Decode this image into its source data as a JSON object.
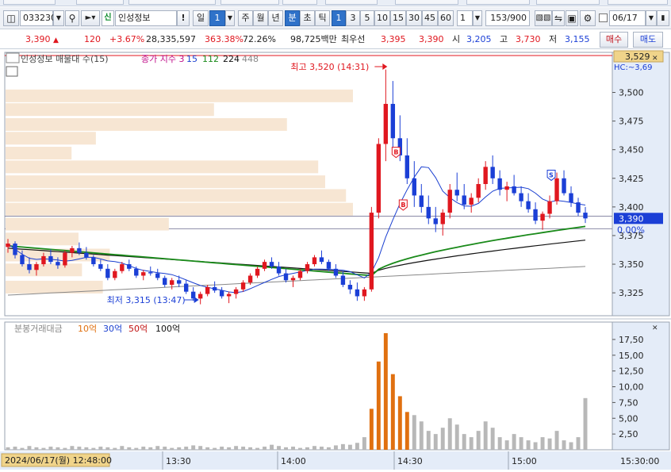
{
  "toolbar": {
    "layout_icon": "layout-icon",
    "stock_code": "033230",
    "dropdown_icon": "chevron-down-icon",
    "search_icon": "search-icon",
    "speaker_icon": "speaker-icon",
    "credit_badge": "신",
    "stock_name": "인성정보",
    "alert_label": "!",
    "period_buttons": [
      "일",
      "1",
      "주",
      "월",
      "년",
      "분",
      "초",
      "틱"
    ],
    "interval_buttons": [
      "1",
      "3",
      "5",
      "10",
      "15",
      "30",
      "45",
      "60"
    ],
    "interval_value": "1",
    "count_display": "153/900",
    "date_value": "06/17"
  },
  "quote": {
    "price": "3,390",
    "change": "120",
    "change_rate": "+3.67%",
    "volume": "28,335,597",
    "volume_ratio": "363.38%",
    "turnover_rate": "72.26%",
    "trade_value": "98,725백만",
    "best_bid_label": "최우선",
    "best_ask_price": "3,395",
    "best_bid_price": "3,390",
    "open_label": "시",
    "open_price": "3,205",
    "high_label": "고",
    "high_price": "3,730",
    "low_label": "저",
    "low_price": "3,155",
    "buy_button": "매수",
    "sell_button": "매도"
  },
  "chart_data": {
    "type": "candlestick",
    "price_panel": {
      "legend_name": "인성정보 매물대 수(15)",
      "legend_ma_title": "종가 지수 3",
      "ma_periods": [
        "15",
        "112",
        "224",
        "448"
      ],
      "ma_colors": [
        "#1a3fd0",
        "#1a8a1a",
        "#111111",
        "#888888"
      ],
      "y_ticks": [
        "3,500",
        "3,475",
        "3,450",
        "3,425",
        "3,400",
        "3,375",
        "3,350",
        "3,325"
      ],
      "ylim": [
        3305,
        3535
      ],
      "current_price_tag": "3,390",
      "top_tag": "3,529",
      "hc_label": "HC:~3,69",
      "zero_pct_label": "0.00%",
      "high_annotation": "최고 3,520 (14:31)",
      "low_annotation": "최저 3,315 (13:47)",
      "buy_signal": "B",
      "sell_signal": "S",
      "volume_profile": [
        {
          "price": 3330,
          "volume": 0.28
        },
        {
          "price": 3345,
          "volume": 0.22
        },
        {
          "price": 3358,
          "volume": 0.3
        },
        {
          "price": 3372,
          "volume": 0.21
        },
        {
          "price": 3385,
          "volume": 0.47
        },
        {
          "price": 3398,
          "volume": 1.0
        },
        {
          "price": 3410,
          "volume": 0.98
        },
        {
          "price": 3422,
          "volume": 0.92
        },
        {
          "price": 3435,
          "volume": 0.9
        },
        {
          "price": 3447,
          "volume": 0.19
        },
        {
          "price": 3460,
          "volume": 0.26
        },
        {
          "price": 3472,
          "volume": 0.81
        },
        {
          "price": 3485,
          "volume": 0.6
        },
        {
          "price": 3497,
          "volume": 1.0
        }
      ],
      "candles": [
        [
          3365,
          3372,
          3360,
          3368
        ],
        [
          3368,
          3370,
          3355,
          3358
        ],
        [
          3358,
          3362,
          3348,
          3350
        ],
        [
          3350,
          3356,
          3342,
          3345
        ],
        [
          3345,
          3352,
          3340,
          3350
        ],
        [
          3350,
          3360,
          3348,
          3357
        ],
        [
          3357,
          3363,
          3350,
          3352
        ],
        [
          3352,
          3356,
          3346,
          3349
        ],
        [
          3349,
          3362,
          3347,
          3360
        ],
        [
          3360,
          3366,
          3356,
          3364
        ],
        [
          3364,
          3369,
          3358,
          3360
        ],
        [
          3360,
          3365,
          3354,
          3356
        ],
        [
          3356,
          3358,
          3348,
          3350
        ],
        [
          3350,
          3354,
          3344,
          3346
        ],
        [
          3346,
          3350,
          3336,
          3338
        ],
        [
          3338,
          3346,
          3336,
          3344
        ],
        [
          3344,
          3352,
          3342,
          3350
        ],
        [
          3350,
          3354,
          3344,
          3346
        ],
        [
          3346,
          3348,
          3338,
          3340
        ],
        [
          3340,
          3345,
          3336,
          3343
        ],
        [
          3343,
          3348,
          3340,
          3342
        ],
        [
          3342,
          3346,
          3336,
          3338
        ],
        [
          3338,
          3340,
          3330,
          3332
        ],
        [
          3332,
          3338,
          3328,
          3336
        ],
        [
          3336,
          3340,
          3330,
          3333
        ],
        [
          3333,
          3336,
          3324,
          3326
        ],
        [
          3326,
          3330,
          3318,
          3320
        ],
        [
          3320,
          3326,
          3315,
          3324
        ],
        [
          3324,
          3332,
          3322,
          3330
        ],
        [
          3330,
          3335,
          3325,
          3327
        ],
        [
          3327,
          3330,
          3320,
          3322
        ],
        [
          3322,
          3326,
          3316,
          3324
        ],
        [
          3324,
          3330,
          3320,
          3328
        ],
        [
          3328,
          3336,
          3326,
          3334
        ],
        [
          3334,
          3342,
          3332,
          3340
        ],
        [
          3340,
          3348,
          3338,
          3346
        ],
        [
          3346,
          3354,
          3344,
          3352
        ],
        [
          3352,
          3356,
          3346,
          3348
        ],
        [
          3348,
          3352,
          3340,
          3342
        ],
        [
          3342,
          3346,
          3334,
          3336
        ],
        [
          3336,
          3340,
          3330,
          3338
        ],
        [
          3338,
          3346,
          3336,
          3344
        ],
        [
          3344,
          3352,
          3342,
          3350
        ],
        [
          3350,
          3358,
          3348,
          3356
        ],
        [
          3356,
          3362,
          3350,
          3352
        ],
        [
          3352,
          3354,
          3344,
          3346
        ],
        [
          3346,
          3350,
          3338,
          3340
        ],
        [
          3340,
          3344,
          3330,
          3332
        ],
        [
          3332,
          3336,
          3324,
          3328
        ],
        [
          3328,
          3334,
          3318,
          3322
        ],
        [
          3322,
          3330,
          3318,
          3328
        ],
        [
          3328,
          3400,
          3326,
          3395
        ],
        [
          3395,
          3460,
          3390,
          3455
        ],
        [
          3455,
          3520,
          3440,
          3490
        ],
        [
          3490,
          3510,
          3450,
          3460
        ],
        [
          3460,
          3480,
          3440,
          3445
        ],
        [
          3445,
          3460,
          3420,
          3425
        ],
        [
          3425,
          3440,
          3400,
          3410
        ],
        [
          3410,
          3420,
          3395,
          3400
        ],
        [
          3400,
          3410,
          3385,
          3390
        ],
        [
          3390,
          3400,
          3378,
          3385
        ],
        [
          3385,
          3398,
          3375,
          3395
        ],
        [
          3395,
          3420,
          3390,
          3415
        ],
        [
          3415,
          3430,
          3405,
          3410
        ],
        [
          3410,
          3420,
          3398,
          3402
        ],
        [
          3402,
          3412,
          3395,
          3408
        ],
        [
          3408,
          3425,
          3404,
          3420
        ],
        [
          3420,
          3440,
          3415,
          3435
        ],
        [
          3435,
          3445,
          3420,
          3425
        ],
        [
          3425,
          3432,
          3410,
          3415
        ],
        [
          3415,
          3422,
          3405,
          3418
        ],
        [
          3418,
          3428,
          3410,
          3412
        ],
        [
          3412,
          3418,
          3400,
          3405
        ],
        [
          3405,
          3412,
          3395,
          3398
        ],
        [
          3398,
          3404,
          3385,
          3388
        ],
        [
          3388,
          3396,
          3380,
          3394
        ],
        [
          3394,
          3410,
          3390,
          3405
        ],
        [
          3405,
          3430,
          3402,
          3425
        ],
        [
          3425,
          3432,
          3410,
          3412
        ],
        [
          3412,
          3418,
          3400,
          3404
        ],
        [
          3404,
          3408,
          3392,
          3395
        ],
        [
          3395,
          3400,
          3386,
          3390
        ]
      ]
    },
    "volume_panel": {
      "legend_title": "분봉거래대금",
      "legend_levels": [
        "10억",
        "30억",
        "50억",
        "100억"
      ],
      "legend_colors": [
        "#e07010",
        "#1a3fd0",
        "#c01010",
        "#111111"
      ],
      "y_ticks": [
        "17,50",
        "15,00",
        "12,50",
        "10,00",
        "7,50",
        "5,00",
        "2,50"
      ],
      "ylim": [
        0,
        19
      ],
      "values": [
        0.4,
        0.5,
        0.3,
        0.6,
        0.4,
        0.3,
        0.5,
        0.4,
        0.3,
        0.6,
        0.5,
        0.4,
        0.3,
        0.5,
        0.4,
        0.3,
        0.6,
        0.4,
        0.3,
        0.5,
        0.4,
        0.6,
        0.5,
        0.3,
        0.4,
        0.5,
        0.7,
        0.6,
        0.4,
        0.3,
        0.5,
        0.4,
        0.6,
        0.5,
        0.4,
        0.3,
        0.5,
        0.8,
        0.6,
        0.4,
        0.5,
        0.3,
        0.4,
        0.6,
        0.5,
        0.4,
        0.7,
        0.9,
        0.8,
        1.1,
        2.0,
        6.5,
        14.0,
        18.5,
        12.0,
        8.5,
        6.0,
        5.5,
        4.5,
        3.0,
        2.5,
        3.5,
        5.0,
        4.0,
        2.5,
        2.0,
        3.0,
        4.5,
        3.5,
        2.0,
        1.5,
        2.5,
        2.0,
        1.5,
        1.2,
        2.0,
        1.8,
        3.0,
        1.5,
        1.2,
        2.0,
        8.2
      ],
      "highlight_range": [
        51,
        56
      ]
    },
    "x_axis": {
      "cursor_label": "2024/06/17(월) 12:48:00",
      "ticks": [
        "13:30",
        "14:00",
        "14:30",
        "15:00"
      ],
      "end_label": "15:30:00"
    }
  }
}
